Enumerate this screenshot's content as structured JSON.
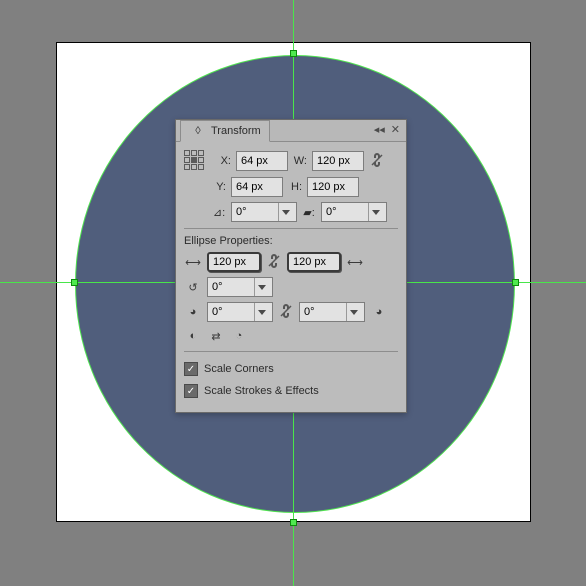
{
  "panel": {
    "title": "Transform",
    "xLabel": "X:",
    "yLabel": "Y:",
    "wLabel": "W:",
    "hLabel": "H:",
    "xVal": "64 px",
    "yVal": "64 px",
    "wVal": "120 px",
    "hVal": "120 px",
    "rotateVal": "0°",
    "shearVal": "0°",
    "ellipseHeader": "Ellipse Properties:",
    "ellipseW": "120 px",
    "ellipseH": "120 px",
    "pieStart": "0°",
    "pieEnd1": "0°",
    "pieEnd2": "0°",
    "scaleCorners": "Scale Corners",
    "scaleStrokes": "Scale Strokes & Effects"
  }
}
